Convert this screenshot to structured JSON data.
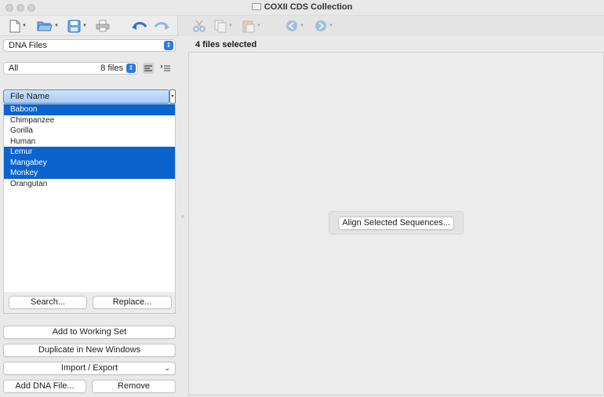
{
  "window": {
    "title": "COXII CDS Collection"
  },
  "toolbar": {
    "icons": [
      "new-document-icon",
      "open-folder-icon",
      "save-icon",
      "print-icon",
      "undo-icon",
      "redo-icon",
      "cut-icon",
      "copy-icon",
      "paste-icon",
      "back-icon",
      "forward-icon"
    ]
  },
  "sidebar": {
    "type_select": "DNA Files",
    "filter_select": "All",
    "file_count": "8 files",
    "column_header": "File Name",
    "files": [
      {
        "name": "Baboon",
        "selected": true
      },
      {
        "name": "Chimpanzee",
        "selected": false
      },
      {
        "name": "Gorilla",
        "selected": false
      },
      {
        "name": "Human",
        "selected": false
      },
      {
        "name": "Lemur",
        "selected": true
      },
      {
        "name": "Mangabey",
        "selected": true
      },
      {
        "name": "Monkey",
        "selected": true
      },
      {
        "name": "Orangutan",
        "selected": false
      }
    ],
    "search_label": "Search...",
    "replace_label": "Replace...",
    "add_working_set": "Add to Working Set",
    "duplicate_windows": "Duplicate in New Windows",
    "import_export": "Import / Export",
    "add_dna_file": "Add DNA File...",
    "remove": "Remove"
  },
  "main": {
    "header": "4 files selected",
    "align_button": "Align Selected Sequences..."
  },
  "colors": {
    "selection": "#0b63ce",
    "accent": "#2a7be4"
  }
}
